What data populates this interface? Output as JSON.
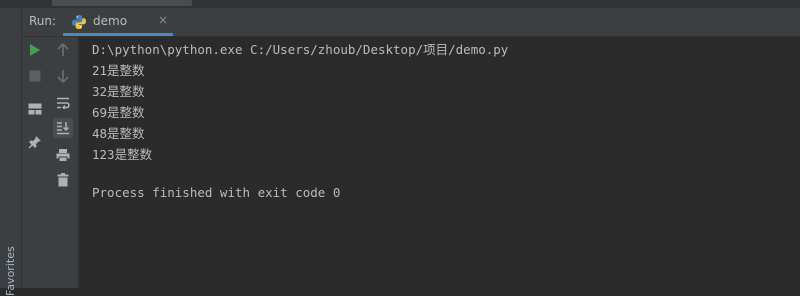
{
  "run_panel": {
    "label": "Run:",
    "tab": {
      "label": "demo",
      "close": "×",
      "icon": "python-icon"
    }
  },
  "sidebar": {
    "favorites_label": "Favorites"
  },
  "toolbar": {
    "col1": [
      "rerun-icon",
      "stop-icon",
      "layout-icon",
      "pin-icon"
    ],
    "col2": [
      "up-arrow-icon",
      "down-arrow-icon",
      "soft-wrap-icon",
      "scroll-to-end-icon",
      "print-icon",
      "trash-icon"
    ]
  },
  "console": {
    "lines": [
      "D:\\python\\python.exe C:/Users/zhoub/Desktop/项目/demo.py",
      "21是整数",
      "32是整数",
      "69是整数",
      "48是整数",
      "123是整数",
      "",
      "Process finished with exit code 0"
    ]
  },
  "colors": {
    "background": "#2b2b2b",
    "panel": "#3c3f41",
    "text": "#bbbbbb",
    "run_green": "#499c54",
    "tab_underline": "#4a88c7"
  }
}
